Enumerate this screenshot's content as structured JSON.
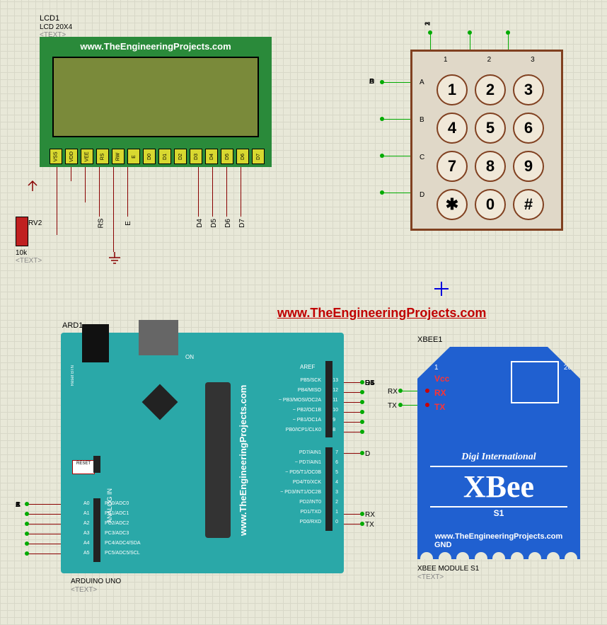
{
  "url": "www.TheEngineeringProjects.com",
  "lcd": {
    "ref": "LCD1",
    "type": "LCD 20X4",
    "txt": "<TEXT>",
    "pins": [
      "VSS",
      "VDD",
      "VEE",
      "RS",
      "RW",
      "E",
      "D0",
      "D1",
      "D2",
      "D3",
      "D4",
      "D5",
      "D6",
      "D7"
    ]
  },
  "pot": {
    "ref": "RV2",
    "val": "10k",
    "txt": "<TEXT>"
  },
  "keypad": {
    "cols": [
      "1",
      "2",
      "3"
    ],
    "rows": [
      "A",
      "B",
      "C",
      "D"
    ],
    "keys": [
      [
        "1",
        "2",
        "3"
      ],
      [
        "4",
        "5",
        "6"
      ],
      [
        "7",
        "8",
        "9"
      ],
      [
        "✱",
        "0",
        "#"
      ]
    ]
  },
  "arduino": {
    "ref": "ARD1",
    "name": "ARDUINO UNO",
    "txt": "<TEXT>",
    "aref": "AREF",
    "reset": "RESET",
    "reset_btn": "Reset\nBTN",
    "analog": "ANALOG IN",
    "on": "ON",
    "analog_pins": [
      "PC0/ADC0",
      "PC1/ADC1",
      "PC2/ADC2",
      "PC3/ADC3",
      "PC4/ADC4/SDA",
      "PC5/ADC5/SCL"
    ],
    "analog_ext": [
      "A0",
      "A1",
      "A2",
      "A3",
      "A4",
      "A5"
    ],
    "dig_hi": [
      "PB5/SCK",
      "PB4/MISO",
      "~ PB3/MOSI/OC2A",
      "~ PB2/OC1B",
      "~ PB1/OC1A",
      "PB0/ICP1/CLK0"
    ],
    "dig_hi_n": [
      "13",
      "12",
      "11",
      "10",
      "9",
      "8"
    ],
    "dig_lo": [
      "PD7/AIN1",
      "~ PD7/AIN1",
      "~ PD5/T1/OC0B",
      "PD4/T0/XCK",
      "~ PD3/INT1/OC2B",
      "PD2/INT0",
      "PD1/TXD",
      "PD0/RXD"
    ],
    "dig_lo_n": [
      "7",
      "6",
      "5",
      "4",
      "3",
      "2",
      "1",
      "0"
    ],
    "ext_hi": [
      "RS",
      "E",
      "D4",
      "D5",
      "D6",
      "D7"
    ],
    "ext_lo0": "D",
    "ext_rx": "RX",
    "ext_tx": "TX",
    "ext_analog": [
      "C",
      "B",
      "A",
      "3",
      "2",
      "1"
    ]
  },
  "xbee": {
    "ref": "XBEE1",
    "type": "XBEE MODULE S1",
    "txt": "<TEXT>",
    "vcc": "Vcc",
    "rx": "RX",
    "tx": "TX",
    "gnd": "GND",
    "pin1": "1",
    "pin20": "20",
    "brand": "Digi International",
    "name": "XBee",
    "s1": "S1",
    "ext_rx": "RX",
    "ext_tx": "TX"
  },
  "net": {
    "rs": "RS",
    "e": "E",
    "d4": "D4",
    "d5": "D5",
    "d6": "D6",
    "d7": "D7"
  }
}
